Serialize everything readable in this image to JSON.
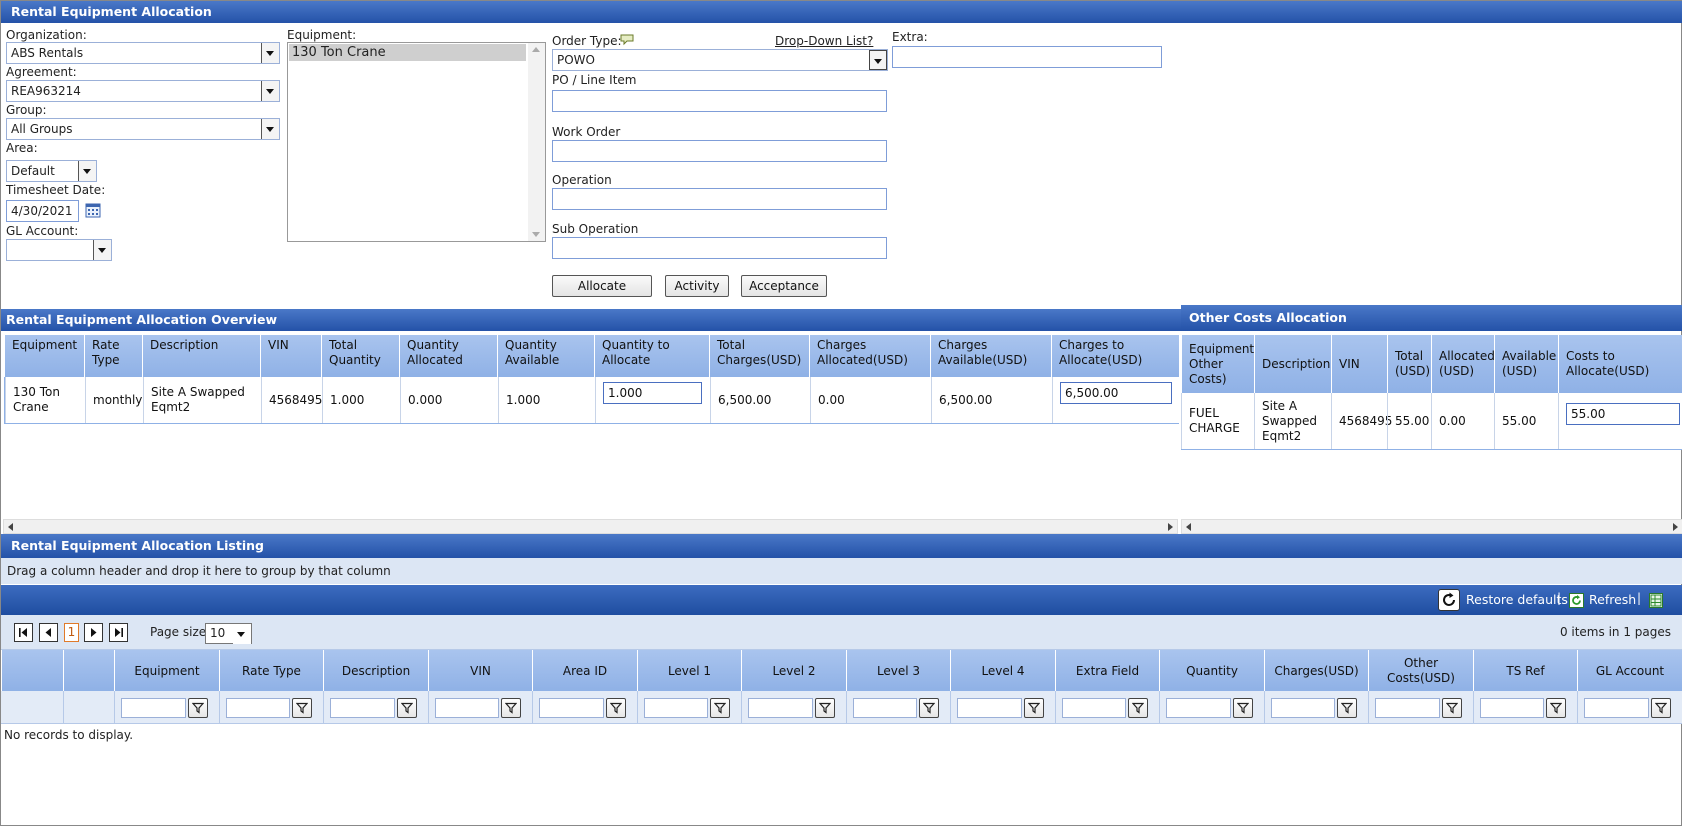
{
  "header": {
    "title": "Rental Equipment Allocation"
  },
  "form": {
    "organization_label": "Organization:",
    "organization_value": "ABS Rentals",
    "agreement_label": "Agreement:",
    "agreement_value": "REA963214",
    "group_label": "Group:",
    "group_value": "All Groups",
    "area_label": "Area:",
    "area_value": "Default",
    "timesheet_label": "Timesheet Date:",
    "timesheet_value": "4/30/2021",
    "gl_label": "GL Account:",
    "gl_value": "",
    "equipment_label": "Equipment:",
    "equipment_items": [
      "130 Ton Crane"
    ],
    "order_type_label": "Order Type:",
    "order_type_value": "POWO",
    "dropdown_list_link": "Drop-Down List?",
    "extra_label": "Extra:",
    "extra_value": "",
    "po_label": "PO / Line Item",
    "po_value": "",
    "work_order_label": "Work Order",
    "work_order_value": "",
    "operation_label": "Operation",
    "operation_value": "",
    "sub_operation_label": "Sub Operation",
    "sub_operation_value": "",
    "allocate_button": "Allocate",
    "activity_button": "Activity",
    "acceptance_button": "Acceptance"
  },
  "overview": {
    "title": "Rental Equipment Allocation Overview",
    "columns": [
      "Equipment",
      "Rate Type",
      "Description",
      "VIN",
      "Total Quantity",
      "Quantity Allocated",
      "Quantity Available",
      "Quantity to Allocate",
      "Total Charges(USD)",
      "Charges Allocated(USD)",
      "Charges Available(USD)",
      "Charges to Allocate(USD)"
    ],
    "rows": [
      [
        "130 Ton Crane",
        "monthly",
        "Site A Swapped Eqmt2",
        "4568495",
        "1.000",
        "0.000",
        "1.000",
        "1.000",
        "6,500.00",
        "0.00",
        "6,500.00",
        "6,500.00"
      ]
    ]
  },
  "other_costs": {
    "title": "Other Costs Allocation",
    "columns": [
      "Equipment Other Costs)",
      "Description",
      "VIN",
      "Total (USD)",
      "Allocated (USD)",
      "Available (USD)",
      "Costs to Allocate(USD)"
    ],
    "rows": [
      [
        "FUEL CHARGE",
        "Site A Swapped Eqmt2",
        "4568495",
        "55.00",
        "0.00",
        "55.00",
        "55.00"
      ]
    ]
  },
  "listing": {
    "title": "Rental Equipment Allocation Listing",
    "group_hint": "Drag a column header and drop it here to group by that column",
    "restore_defaults": "Restore defaults",
    "refresh": "Refresh",
    "current_page": "1",
    "page_size_label": "Page size:",
    "page_size_value": "10",
    "items_info": "0 items in 1 pages",
    "columns": [
      "Equipment",
      "Rate Type",
      "Description",
      "VIN",
      "Area ID",
      "Level 1",
      "Level 2",
      "Level 3",
      "Level 4",
      "Extra Field",
      "Quantity",
      "Charges(USD)",
      "Other Costs(USD)",
      "TS Ref",
      "GL Account"
    ],
    "empty_message": "No records to display."
  }
}
